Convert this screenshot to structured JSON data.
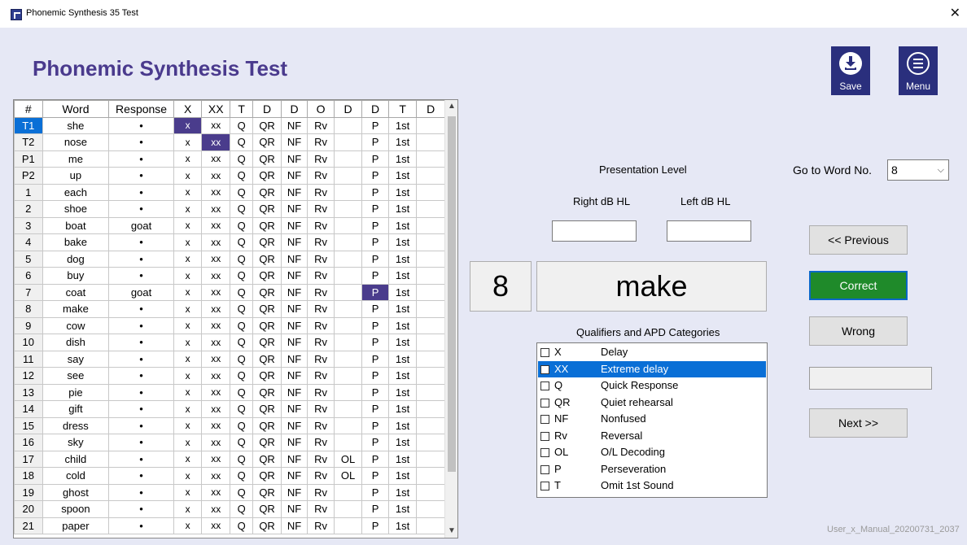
{
  "window": {
    "title": "Phonemic Synthesis 35 Test",
    "close": "✕"
  },
  "heading": "Phonemic Synthesis Test",
  "toolbar": {
    "save_label": "Save",
    "menu_label": "Menu"
  },
  "grid": {
    "headers": [
      "#",
      "Word",
      "Response",
      "X",
      "XX",
      "T",
      "D",
      "D",
      "O",
      "D",
      "D",
      "T",
      "D"
    ],
    "rows": [
      {
        "num": "T1",
        "word": "she",
        "resp": "•",
        "ol": "",
        "sel": true,
        "hl": "x"
      },
      {
        "num": "T2",
        "word": "nose",
        "resp": "•",
        "ol": "",
        "hl": "xx"
      },
      {
        "num": "P1",
        "word": "me",
        "resp": "•",
        "ol": ""
      },
      {
        "num": "P2",
        "word": "up",
        "resp": "•",
        "ol": ""
      },
      {
        "num": "1",
        "word": "each",
        "resp": "•",
        "ol": ""
      },
      {
        "num": "2",
        "word": "shoe",
        "resp": "•",
        "ol": ""
      },
      {
        "num": "3",
        "word": "boat",
        "resp": "goat",
        "ol": ""
      },
      {
        "num": "4",
        "word": "bake",
        "resp": "•",
        "ol": ""
      },
      {
        "num": "5",
        "word": "dog",
        "resp": "•",
        "ol": ""
      },
      {
        "num": "6",
        "word": "buy",
        "resp": "•",
        "ol": ""
      },
      {
        "num": "7",
        "word": "coat",
        "resp": "goat",
        "ol": "",
        "hl": "p"
      },
      {
        "num": "8",
        "word": "make",
        "resp": "•",
        "ol": ""
      },
      {
        "num": "9",
        "word": "cow",
        "resp": "•",
        "ol": ""
      },
      {
        "num": "10",
        "word": "dish",
        "resp": "•",
        "ol": ""
      },
      {
        "num": "11",
        "word": "say",
        "resp": "•",
        "ol": ""
      },
      {
        "num": "12",
        "word": "see",
        "resp": "•",
        "ol": ""
      },
      {
        "num": "13",
        "word": "pie",
        "resp": "•",
        "ol": ""
      },
      {
        "num": "14",
        "word": "gift",
        "resp": "•",
        "ol": ""
      },
      {
        "num": "15",
        "word": "dress",
        "resp": "•",
        "ol": ""
      },
      {
        "num": "16",
        "word": "sky",
        "resp": "•",
        "ol": ""
      },
      {
        "num": "17",
        "word": "child",
        "resp": "•",
        "ol": "OL"
      },
      {
        "num": "18",
        "word": "cold",
        "resp": "•",
        "ol": "OL"
      },
      {
        "num": "19",
        "word": "ghost",
        "resp": "•",
        "ol": ""
      },
      {
        "num": "20",
        "word": "spoon",
        "resp": "•",
        "ol": ""
      },
      {
        "num": "21",
        "word": "paper",
        "resp": "•",
        "ol": ""
      }
    ],
    "cell_labels": {
      "x": "x",
      "xx": "xx",
      "q": "Q",
      "qr": "QR",
      "nf": "NF",
      "rv": "Rv",
      "p": "P",
      "first": "1st"
    },
    "scroll_up": "▲",
    "scroll_down": "▼"
  },
  "presentation": {
    "label": "Presentation Level",
    "right_label": "Right dB HL",
    "left_label": "Left dB HL",
    "right_value": "",
    "left_value": ""
  },
  "current": {
    "number": "8",
    "word": "make"
  },
  "qualifiers": {
    "label": "Qualifiers and APD Categories",
    "items": [
      {
        "code": "X",
        "desc": "Delay"
      },
      {
        "code": "XX",
        "desc": "Extreme delay",
        "selected": true
      },
      {
        "code": "Q",
        "desc": "Quick Response"
      },
      {
        "code": "QR",
        "desc": "Quiet rehearsal"
      },
      {
        "code": "NF",
        "desc": "Nonfused"
      },
      {
        "code": "Rv",
        "desc": "Reversal"
      },
      {
        "code": "OL",
        "desc": "O/L Decoding"
      },
      {
        "code": "P",
        "desc": "Perseveration"
      },
      {
        "code": "T",
        "desc": "Omit 1st Sound"
      }
    ]
  },
  "goto": {
    "label": "Go to Word No.",
    "value": "8"
  },
  "buttons": {
    "previous": "<< Previous",
    "correct": "Correct",
    "wrong": "Wrong",
    "next": "Next >>"
  },
  "blank_field": "",
  "footer": "User_x_Manual_20200731_2037",
  "colors": {
    "accent": "#4a3a8d",
    "selection": "#0a6fd6",
    "correct": "#1f8a2a",
    "icon_button": "#2a2f7d"
  }
}
